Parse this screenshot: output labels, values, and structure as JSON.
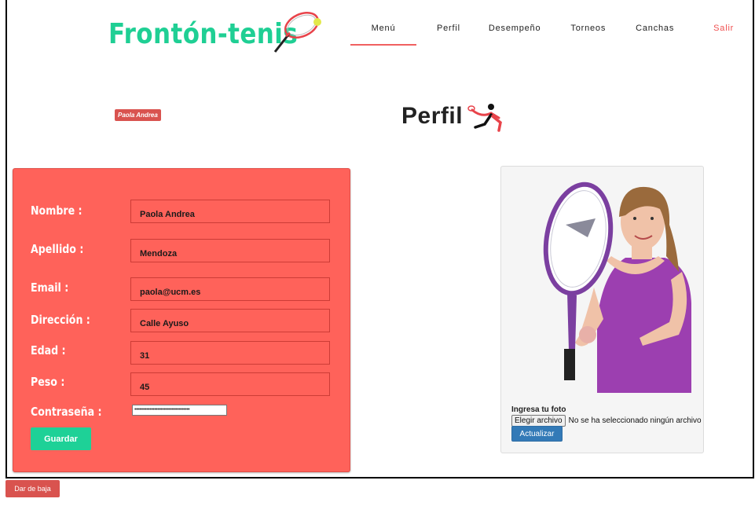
{
  "header": {
    "logo_text": "Frontón-tenis",
    "nav": [
      {
        "label": "Menú",
        "active": true
      },
      {
        "label": "Perfil"
      },
      {
        "label": "Desempeño"
      },
      {
        "label": "Torneos"
      },
      {
        "label": "Canchas"
      },
      {
        "label": "Salir",
        "color": "#f05050"
      }
    ]
  },
  "user_badge": "Paola Andrea",
  "page_title": "Perfil",
  "form": {
    "fields": [
      {
        "label": "Nombre :",
        "value": "Paola Andrea"
      },
      {
        "label": "Apellido :",
        "value": "Mendoza"
      },
      {
        "label": "Email :",
        "value": "paola@ucm.es"
      },
      {
        "label": "Dirección :",
        "value": "Calle Ayuso"
      },
      {
        "label": "Edad :",
        "value": "31"
      },
      {
        "label": "Peso :",
        "value": "45"
      }
    ],
    "password_label": "Contraseña :",
    "password_mask": "••••••••••••••••••••••••••••••••••••",
    "save_label": "Guardar"
  },
  "photo": {
    "upload_label": "Ingresa tu foto",
    "choose_file_label": "Elegir archivo",
    "no_file_text": "No se ha seleccionado ningún archivo",
    "update_label": "Actualizar"
  },
  "delete_account_label": "Dar de baja",
  "colors": {
    "brand_green": "#1fcf94",
    "form_bg": "#ff625a",
    "badge_red": "#d9534f",
    "primary_blue": "#337ab7",
    "nav_accent": "#f06060"
  }
}
